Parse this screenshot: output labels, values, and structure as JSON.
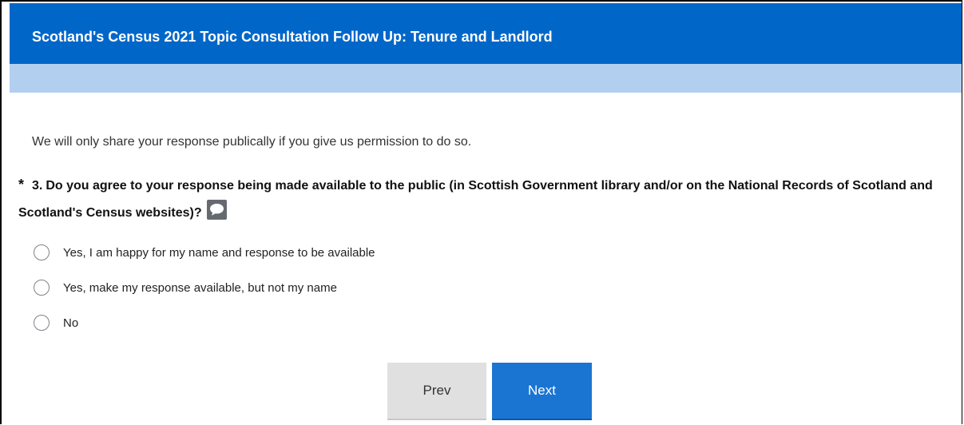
{
  "survey": {
    "title": "Scotland's Census 2021 Topic Consultation Follow Up: Tenure and Landlord"
  },
  "intro_text": "We will only share your response publically if you give us permission to do so.",
  "question": {
    "required_marker": "*",
    "number": "3.",
    "text": "Do you agree to your response being made available to the public (in Scottish Government library and/or on the National Records of Scotland and Scotland's Census websites)?",
    "comment_icon": "comment-icon",
    "options": [
      {
        "label": "Yes, I am happy for my name and response to be available",
        "selected": false
      },
      {
        "label": "Yes, make my response available, but not my name",
        "selected": false
      },
      {
        "label": "No",
        "selected": false
      }
    ]
  },
  "nav": {
    "prev_label": "Prev",
    "next_label": "Next"
  },
  "colors": {
    "title_bar": "#0067c9",
    "sub_bar": "#b3cff0",
    "next_button": "#1a75d2",
    "prev_button": "#e0e0e0"
  }
}
